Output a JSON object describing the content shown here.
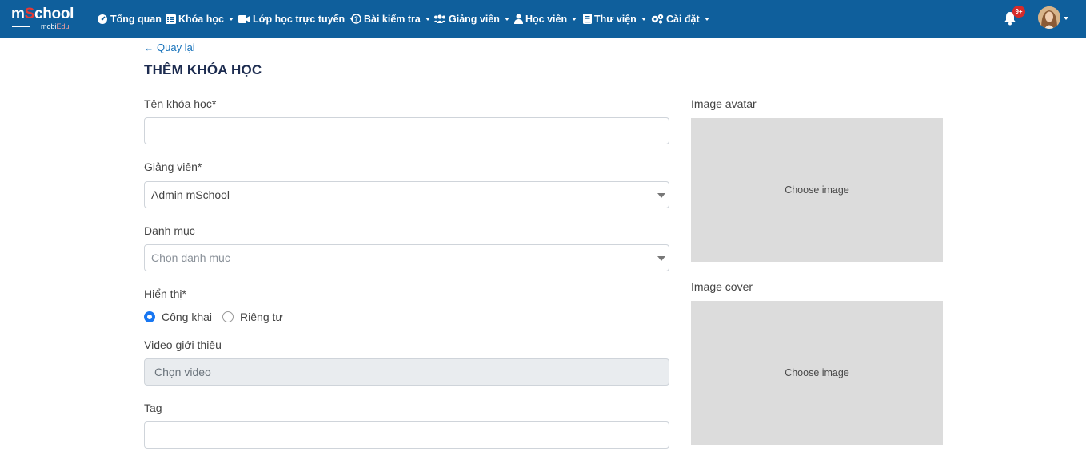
{
  "brand": {
    "logo_prefix": "m",
    "logo_o": "S",
    "logo_rest": "chool",
    "sub_a": "mobi",
    "sub_b": "Edu"
  },
  "nav": {
    "items": [
      {
        "label": "Tổng quan",
        "icon": "dashboard-icon",
        "has_caret": false
      },
      {
        "label": "Khóa học",
        "icon": "list-icon",
        "has_caret": true
      },
      {
        "label": "Lớp học trực tuyến",
        "icon": "video-icon",
        "has_caret": true
      },
      {
        "label": "Bài kiểm tra",
        "icon": "question-circle-icon",
        "has_caret": true
      },
      {
        "label": "Giảng viên",
        "icon": "users-icon",
        "has_caret": true
      },
      {
        "label": "Học viên",
        "icon": "user-icon",
        "has_caret": true
      },
      {
        "label": "Thư viện",
        "icon": "book-icon",
        "has_caret": true
      },
      {
        "label": "Cài đặt",
        "icon": "cogs-icon",
        "has_caret": true
      }
    ],
    "notification_badge": "9+"
  },
  "page": {
    "back_label": "Quay lại",
    "title": "THÊM KHÓA HỌC"
  },
  "form": {
    "course_name": {
      "label": "Tên khóa học*",
      "value": ""
    },
    "instructor": {
      "label": "Giảng viên*",
      "value": "Admin mSchool"
    },
    "category": {
      "label": "Danh mục",
      "placeholder": "Chọn danh mục"
    },
    "visibility": {
      "label": "Hiển thị*",
      "options": [
        "Công khai",
        "Riêng tư"
      ],
      "selected": "Công khai"
    },
    "intro_video": {
      "label": "Video giới thiệu",
      "placeholder": "Chọn video"
    },
    "tag": {
      "label": "Tag",
      "value": ""
    }
  },
  "images": {
    "avatar": {
      "label": "Image avatar",
      "button": "Choose image"
    },
    "cover": {
      "label": "Image cover",
      "button": "Choose image"
    }
  },
  "colors": {
    "navbar": "#0f5f9c",
    "accent": "#1c75bc",
    "badge": "#d62b2b",
    "image_placeholder": "#dcdcdc"
  }
}
